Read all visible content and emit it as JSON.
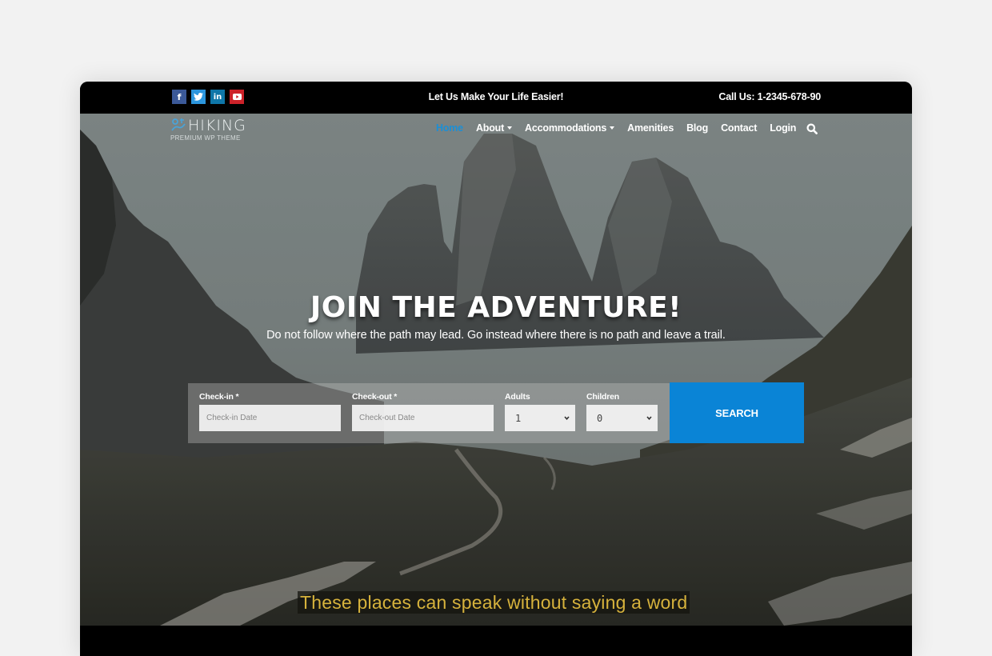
{
  "topbar": {
    "socials": [
      {
        "name": "facebook",
        "glyph": "f",
        "color": "#3b5998"
      },
      {
        "name": "twitter",
        "glyph": "t",
        "color": "#2b95dd"
      },
      {
        "name": "linkedin",
        "glyph": "in",
        "color": "#0e76a8"
      },
      {
        "name": "youtube",
        "glyph": "▶",
        "color": "#cc2229"
      }
    ],
    "tagline": "Let Us Make Your Life Easier!",
    "phone": "Call Us: 1-2345-678-90"
  },
  "logo": {
    "title": "HIKING",
    "subtitle": "PREMIUM WP THEME"
  },
  "nav": {
    "items": [
      {
        "label": "Home",
        "active": true,
        "dropdown": false
      },
      {
        "label": "About",
        "active": false,
        "dropdown": true
      },
      {
        "label": "Accommodations",
        "active": false,
        "dropdown": true
      },
      {
        "label": "Amenities",
        "active": false,
        "dropdown": false
      },
      {
        "label": "Blog",
        "active": false,
        "dropdown": false
      },
      {
        "label": "Contact",
        "active": false,
        "dropdown": false
      },
      {
        "label": "Login",
        "active": false,
        "dropdown": false
      }
    ],
    "accent_color": "#1b8fd6"
  },
  "hero": {
    "headline": "JOIN THE ADVENTURE!",
    "subline": "Do not follow where the path may lead. Go instead where there is no path and leave a trail.",
    "caption": "These places can speak without saying a word"
  },
  "booking": {
    "checkin": {
      "label": "Check-in *",
      "placeholder": "Check-in Date",
      "value": ""
    },
    "checkout": {
      "label": "Check-out *",
      "placeholder": "Check-out Date",
      "value": ""
    },
    "adults": {
      "label": "Adults",
      "value": "1"
    },
    "children": {
      "label": "Children",
      "value": "0"
    },
    "search_label": "SEARCH",
    "button_color": "#0a84d6"
  }
}
